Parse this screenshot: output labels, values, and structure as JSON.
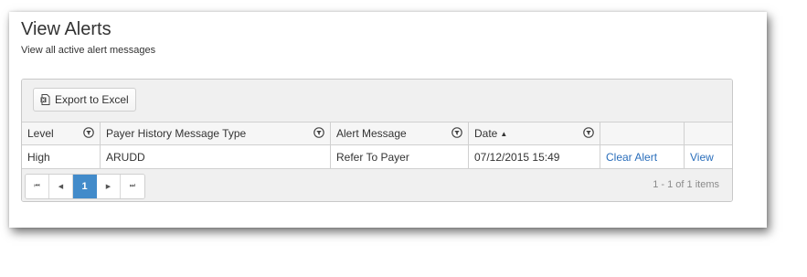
{
  "header": {
    "title": "View Alerts",
    "subtitle": "View all active alert messages"
  },
  "toolbar": {
    "export_label": "Export to Excel",
    "export_icon": "excel-file-icon"
  },
  "table": {
    "columns": [
      {
        "label": "Level",
        "filter": true
      },
      {
        "label": "Payer History Message Type",
        "filter": true
      },
      {
        "label": "Alert Message",
        "filter": true
      },
      {
        "label": "Date",
        "sort": "ascending",
        "filter": true
      },
      {
        "label": "",
        "filter": false
      },
      {
        "label": "",
        "filter": false
      }
    ],
    "rows": [
      {
        "level": "High",
        "message_type": "ARUDD",
        "alert_message": "Refer To Payer",
        "date": "07/12/2015 15:49",
        "clear_action": "Clear Alert",
        "view_action": "View"
      }
    ]
  },
  "pager": {
    "first": "⏮",
    "prev": "◀",
    "current_page": "1",
    "next": "▶",
    "last": "⏭",
    "info": "1 - 1 of 1 items"
  },
  "colors": {
    "link": "#2a6ebb",
    "active_page": "#428bca"
  }
}
